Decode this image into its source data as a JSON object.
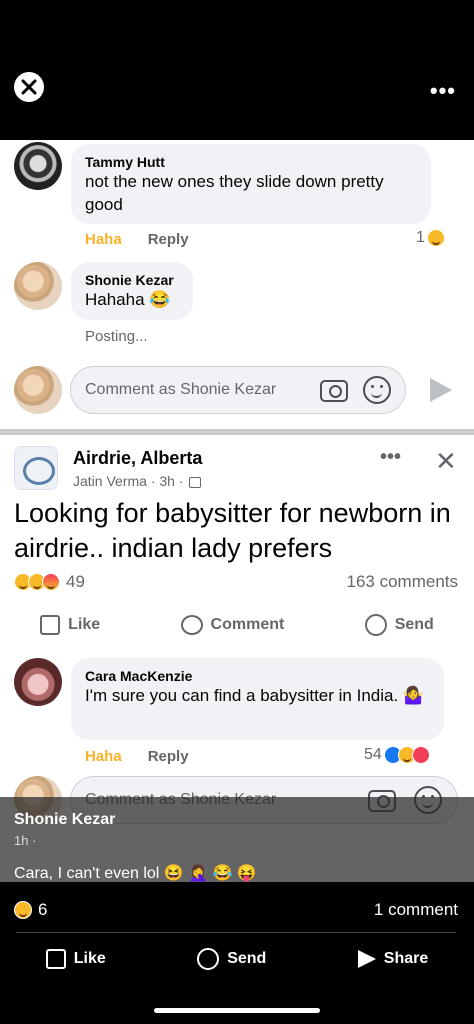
{
  "top": {
    "close_icon": "close-icon",
    "more_label": "•••"
  },
  "comments_top": [
    {
      "name": "Tammy Hutt",
      "text": "not the new ones they slide down pretty good",
      "action1": "Haha",
      "action2": "Reply",
      "react_count": "1"
    },
    {
      "name": "Shonie Kezar",
      "text": "Hahaha 😂",
      "status": "Posting..."
    }
  ],
  "comment_input": {
    "placeholder": "Comment as Shonie Kezar"
  },
  "post": {
    "group": "Airdrie, Alberta",
    "author_meta": "Jatin Verma · 3h ·",
    "more_label": "•••",
    "close_label": "✕",
    "body": "Looking for babysitter for newborn in airdrie.. indian lady prefers",
    "reaction_count": "49",
    "comment_count": "163 comments",
    "actions": {
      "like": "Like",
      "comment": "Comment",
      "send": "Send"
    }
  },
  "comment_mid": {
    "name": "Cara MacKenzie",
    "text": "I'm sure you can find a babysitter in India. 🤷‍♀️",
    "action1": "Haha",
    "action2": "Reply",
    "react_count": "54"
  },
  "comment_input2": {
    "placeholder": "Comment as Shonie Kezar"
  },
  "overlay": {
    "name": "Shonie Kezar",
    "time": "1h ·",
    "caption": "Cara, I can't even lol 😆 🤦‍♀️ 😂 😝"
  },
  "bottom": {
    "reaction_count": "6",
    "comment_count": "1 comment",
    "actions": {
      "like": "Like",
      "send": "Send",
      "share": "Share"
    }
  }
}
